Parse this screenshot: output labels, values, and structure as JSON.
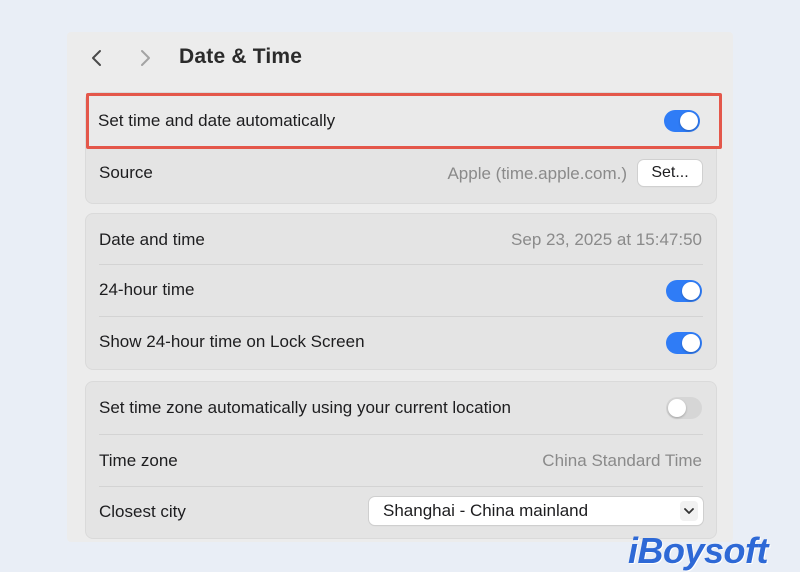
{
  "header": {
    "title": "Date & Time",
    "back_icon": "chevron-left-icon",
    "forward_icon": "chevron-right-icon"
  },
  "auto_group": {
    "set_auto": {
      "label": "Set time and date automatically",
      "enabled": true
    },
    "source": {
      "label": "Source",
      "value": "Apple (time.apple.com.)",
      "button_label": "Set..."
    }
  },
  "datetime_group": {
    "date_and_time": {
      "label": "Date and time",
      "value": "Sep 23, 2025 at 15:47:50"
    },
    "hour24": {
      "label": "24-hour time",
      "enabled": true
    },
    "lock_screen": {
      "label": "Show 24-hour time on Lock Screen",
      "enabled": true
    }
  },
  "timezone_group": {
    "auto_timezone": {
      "label": "Set time zone automatically using your current location",
      "enabled": false
    },
    "time_zone": {
      "label": "Time zone",
      "value": "China Standard Time"
    },
    "closest_city": {
      "label": "Closest city",
      "selected": "Shanghai - China mainland"
    }
  },
  "watermark": {
    "text": "iBoysoft"
  },
  "colors": {
    "accent": "#2f7cf6",
    "highlight_border": "#e4574a",
    "toggle_off": "#d6d6d6",
    "watermark": "#2e69d6"
  }
}
